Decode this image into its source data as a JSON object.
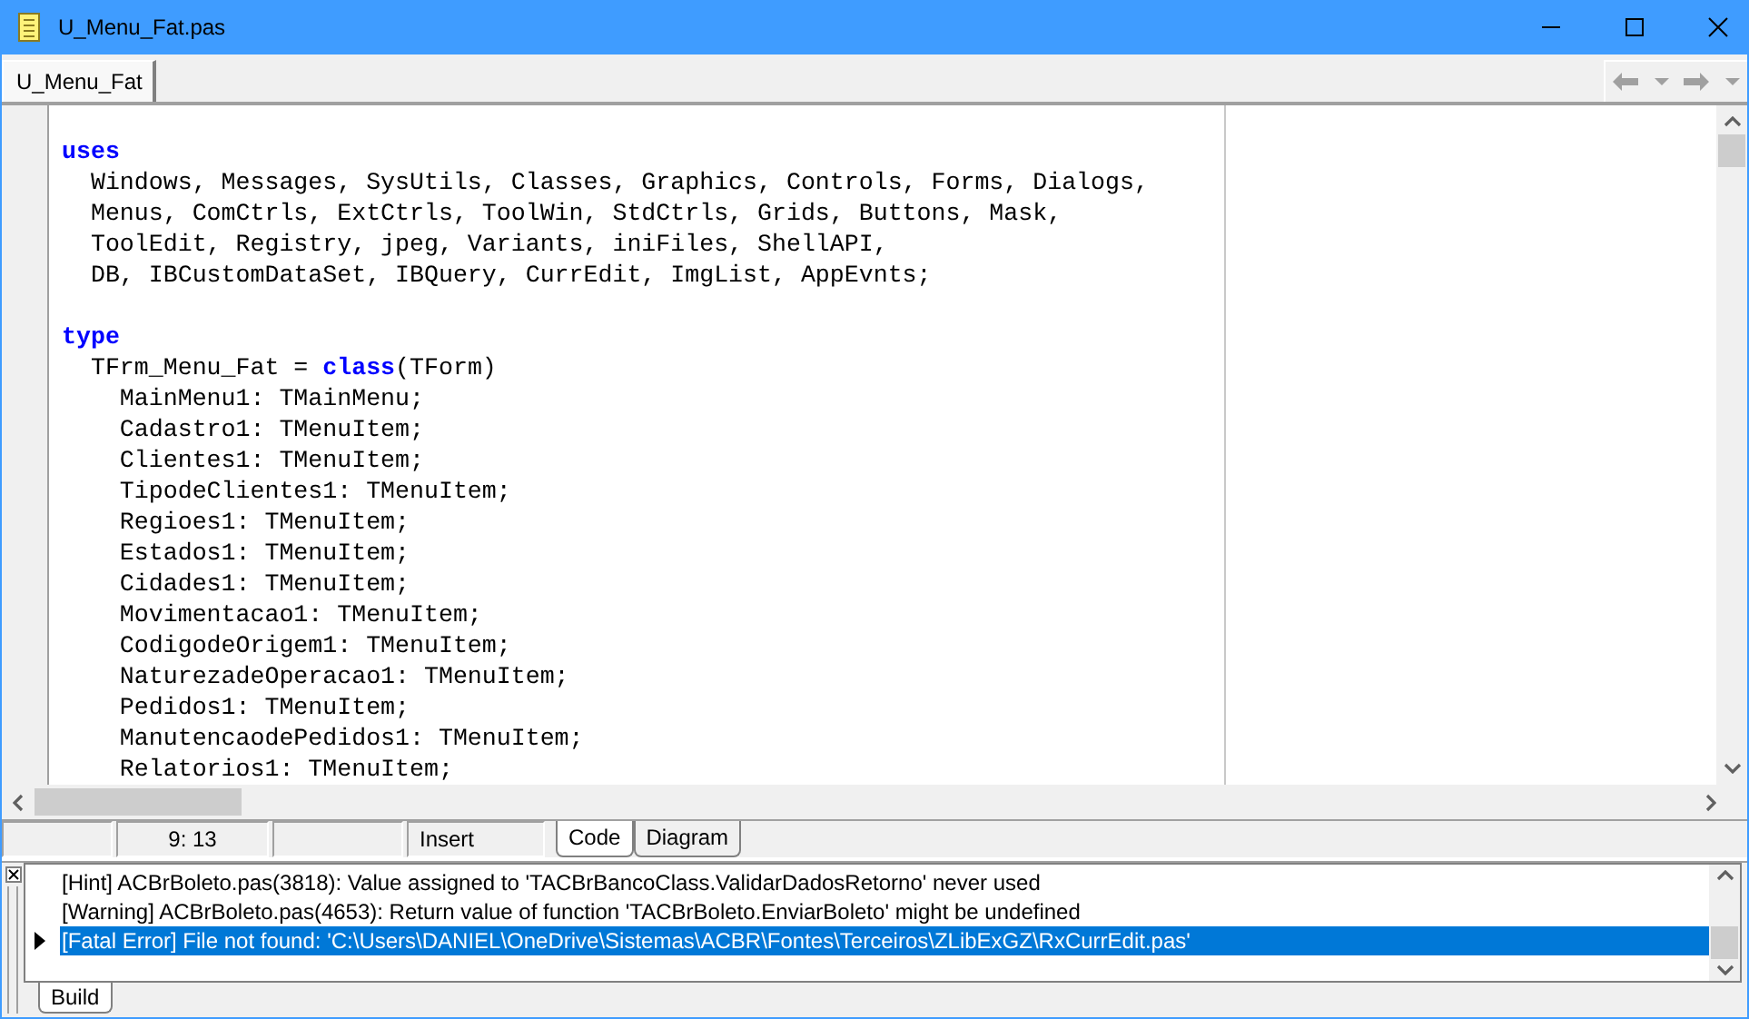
{
  "window": {
    "title": "U_Menu_Fat.pas"
  },
  "file_tabs": [
    {
      "label": "U_Menu_Fat",
      "selected": true
    }
  ],
  "code_lines": [
    {
      "kind": "code",
      "segments": [
        {
          "kind": "keyword",
          "text": "uses"
        }
      ]
    },
    {
      "kind": "code",
      "segments": [
        {
          "kind": "plain",
          "text": "  Windows, Messages, SysUtils, Classes, Graphics, Controls, Forms, Dialogs,"
        }
      ]
    },
    {
      "kind": "code",
      "segments": [
        {
          "kind": "plain",
          "text": "  Menus, ComCtrls, ExtCtrls, ToolWin, StdCtrls, Grids, Buttons, Mask,"
        }
      ]
    },
    {
      "kind": "code",
      "segments": [
        {
          "kind": "plain",
          "text": "  ToolEdit, Registry, jpeg, Variants, iniFiles, ShellAPI,"
        }
      ]
    },
    {
      "kind": "code",
      "segments": [
        {
          "kind": "plain",
          "text": "  DB, IBCustomDataSet, IBQuery, CurrEdit, ImgList, AppEvnts;"
        }
      ]
    },
    {
      "kind": "blank"
    },
    {
      "kind": "code",
      "segments": [
        {
          "kind": "keyword",
          "text": "type"
        }
      ]
    },
    {
      "kind": "code",
      "segments": [
        {
          "kind": "plain",
          "text": "  TFrm_Menu_Fat = "
        },
        {
          "kind": "keyword",
          "text": "class"
        },
        {
          "kind": "plain",
          "text": "(TForm)"
        }
      ]
    },
    {
      "kind": "code",
      "segments": [
        {
          "kind": "plain",
          "text": "    MainMenu1: TMainMenu;"
        }
      ]
    },
    {
      "kind": "code",
      "segments": [
        {
          "kind": "plain",
          "text": "    Cadastro1: TMenuItem;"
        }
      ]
    },
    {
      "kind": "code",
      "segments": [
        {
          "kind": "plain",
          "text": "    Clientes1: TMenuItem;"
        }
      ]
    },
    {
      "kind": "code",
      "segments": [
        {
          "kind": "plain",
          "text": "    TipodeClientes1: TMenuItem;"
        }
      ]
    },
    {
      "kind": "code",
      "segments": [
        {
          "kind": "plain",
          "text": "    Regioes1: TMenuItem;"
        }
      ]
    },
    {
      "kind": "code",
      "segments": [
        {
          "kind": "plain",
          "text": "    Estados1: TMenuItem;"
        }
      ]
    },
    {
      "kind": "code",
      "segments": [
        {
          "kind": "plain",
          "text": "    Cidades1: TMenuItem;"
        }
      ]
    },
    {
      "kind": "code",
      "segments": [
        {
          "kind": "plain",
          "text": "    Movimentacao1: TMenuItem;"
        }
      ]
    },
    {
      "kind": "code",
      "segments": [
        {
          "kind": "plain",
          "text": "    CodigodeOrigem1: TMenuItem;"
        }
      ]
    },
    {
      "kind": "code",
      "segments": [
        {
          "kind": "plain",
          "text": "    NaturezadeOperacao1: TMenuItem;"
        }
      ]
    },
    {
      "kind": "code",
      "segments": [
        {
          "kind": "plain",
          "text": "    Pedidos1: TMenuItem;"
        }
      ]
    },
    {
      "kind": "code",
      "segments": [
        {
          "kind": "plain",
          "text": "    ManutencaodePedidos1: TMenuItem;"
        }
      ]
    },
    {
      "kind": "code",
      "segments": [
        {
          "kind": "plain",
          "text": "    Relatorios1: TMenuItem;"
        }
      ]
    }
  ],
  "status_bar": {
    "position": "9:  13",
    "mode": "Insert"
  },
  "view_tabs": [
    {
      "label": "Code",
      "selected": true
    },
    {
      "label": "Diagram",
      "selected": false
    }
  ],
  "messages": [
    {
      "text": "[Hint] ACBrBoleto.pas(3818): Value assigned to 'TACBrBancoClass.ValidarDadosRetorno' never used",
      "selected": false
    },
    {
      "text": "[Warning] ACBrBoleto.pas(4653): Return value of function 'TACBrBoleto.EnviarBoleto' might be undefined",
      "selected": false
    },
    {
      "text": "[Fatal Error] File not found: 'C:\\Users\\DANIEL\\OneDrive\\Sistemas\\ACBR\\Fontes\\Terceiros\\ZLibExGZ\\RxCurrEdit.pas'",
      "selected": true
    }
  ],
  "message_tabs": [
    {
      "label": "Build",
      "selected": true
    }
  ]
}
